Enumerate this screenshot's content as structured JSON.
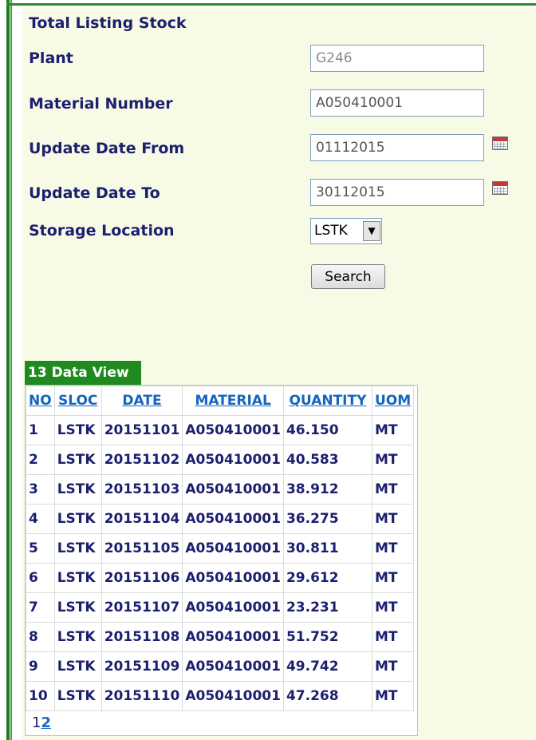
{
  "form": {
    "title": "Total Listing Stock",
    "plant_label": "Plant",
    "plant_value": "G246",
    "material_label": "Material Number",
    "material_value": "A050410001",
    "date_from_label": "Update Date From",
    "date_from_value": "01112015",
    "date_to_label": "Update Date To",
    "date_to_value": "30112015",
    "storage_label": "Storage Location",
    "storage_value": "LSTK",
    "search_label": "Search",
    "calendar_icon": "calendar-icon",
    "dropdown_icon": "chevron-down-icon"
  },
  "grid": {
    "caption": "13 Data View",
    "columns": [
      "NO",
      "SLOC",
      "DATE",
      "MATERIAL",
      "QUANTITY",
      "UOM"
    ],
    "rows": [
      [
        "1",
        "LSTK",
        "20151101",
        "A050410001",
        "46.150",
        "MT"
      ],
      [
        "2",
        "LSTK",
        "20151102",
        "A050410001",
        "40.583",
        "MT"
      ],
      [
        "3",
        "LSTK",
        "20151103",
        "A050410001",
        "38.912",
        "MT"
      ],
      [
        "4",
        "LSTK",
        "20151104",
        "A050410001",
        "36.275",
        "MT"
      ],
      [
        "5",
        "LSTK",
        "20151105",
        "A050410001",
        "30.811",
        "MT"
      ],
      [
        "6",
        "LSTK",
        "20151106",
        "A050410001",
        "29.612",
        "MT"
      ],
      [
        "7",
        "LSTK",
        "20151107",
        "A050410001",
        "23.231",
        "MT"
      ],
      [
        "8",
        "LSTK",
        "20151108",
        "A050410001",
        "51.752",
        "MT"
      ],
      [
        "9",
        "LSTK",
        "20151109",
        "A050410001",
        "49.742",
        "MT"
      ],
      [
        "10",
        "LSTK",
        "20151110",
        "A050410001",
        "47.268",
        "MT"
      ]
    ],
    "pager": {
      "current": "1",
      "next": "2"
    }
  },
  "colors": {
    "accent_green": "#1f8a1f",
    "label_navy": "#1b1f6e",
    "link_blue": "#1565c0",
    "panel_bg": "#f7fbe6"
  }
}
